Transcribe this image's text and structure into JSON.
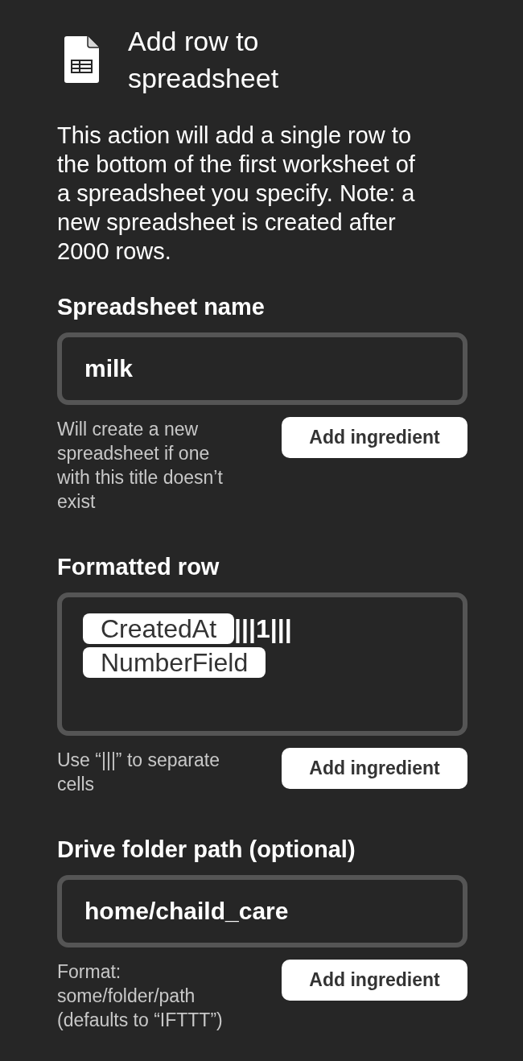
{
  "action": {
    "title": "Add row to spreadsheet",
    "description": "This action will add a single row to the bottom of the first worksheet of a spreadsheet you specify. Note: a new spreadsheet is created after 2000 rows."
  },
  "fields": [
    {
      "kind": "text",
      "label": "Spreadsheet name",
      "value": "milk",
      "help": "Will create a new spreadsheet if one with this title doesn’t exist",
      "button": "Add ingredient"
    },
    {
      "kind": "rich",
      "label": "Formatted row",
      "segments": [
        {
          "kind": "ingredient",
          "text": "CreatedAt"
        },
        {
          "kind": "text",
          "text": "|||1|||"
        },
        {
          "kind": "ingredient",
          "text": "NumberField"
        }
      ],
      "help": "Use “|||” to separate cells",
      "button": "Add ingredient"
    },
    {
      "kind": "text",
      "label": "Drive folder path (optional)",
      "value": "home/chaild_care",
      "help": "Format: some/folder/path (defaults to “IFTTT”)",
      "button": "Add ingredient"
    }
  ]
}
